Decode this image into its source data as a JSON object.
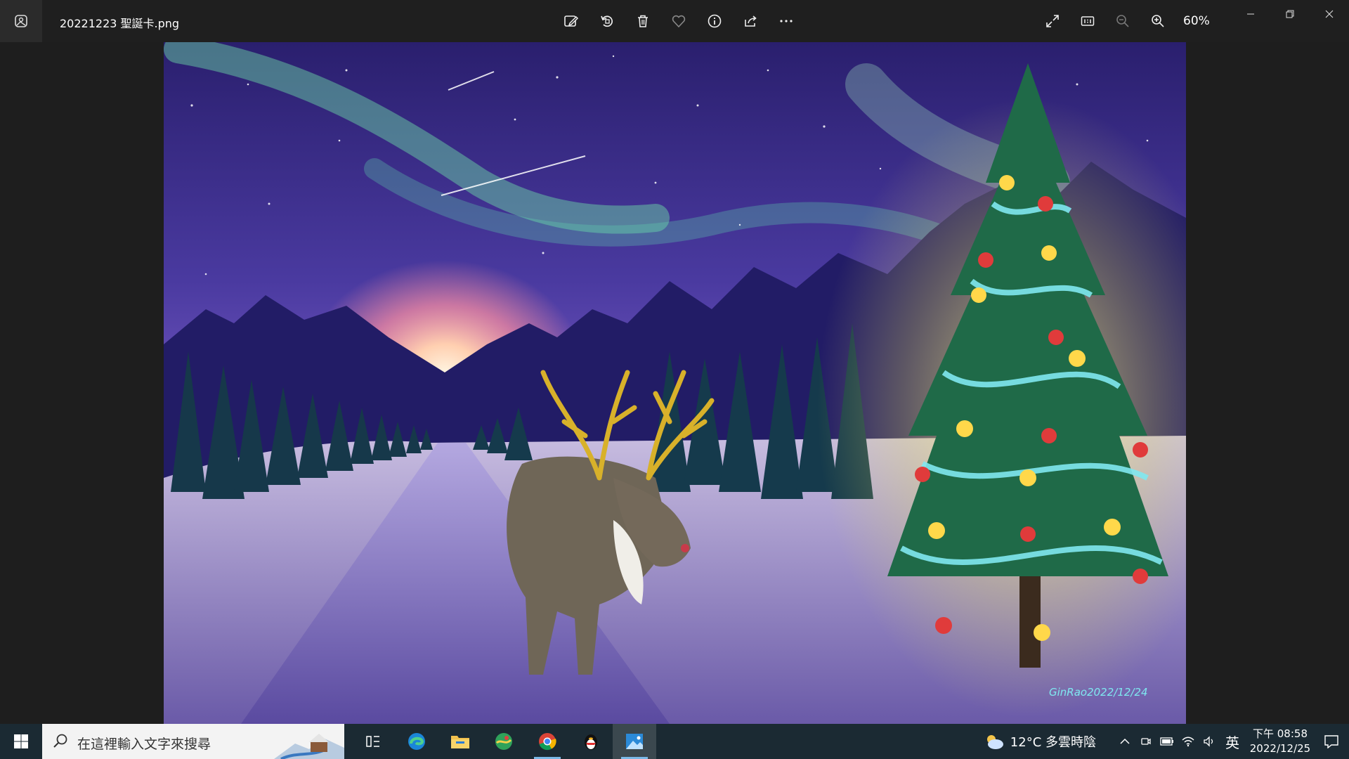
{
  "window": {
    "file_name": "20221223 聖誕卡.png",
    "zoom_level": "60%"
  },
  "toolbar": {
    "items": [
      {
        "name": "edit-image-icon",
        "label": "Edit"
      },
      {
        "name": "rotate-icon",
        "label": "Rotate"
      },
      {
        "name": "delete-icon",
        "label": "Delete"
      },
      {
        "name": "favorite-icon",
        "label": "Favorite"
      },
      {
        "name": "info-icon",
        "label": "Info"
      },
      {
        "name": "share-icon",
        "label": "Share"
      },
      {
        "name": "more-icon",
        "label": "More"
      }
    ]
  },
  "artwork": {
    "signature": "GinRao2022/12/24"
  },
  "taskbar": {
    "search_placeholder": "在這裡輸入文字來搜尋",
    "weather": "12°C 多雲時陰",
    "ime": "英",
    "time": "下午 08:58",
    "date": "2022/12/25"
  },
  "colors": {
    "titlebar": "#1f1f1f",
    "taskbar": "#1b2a33",
    "accent": "#7ab8e6"
  }
}
